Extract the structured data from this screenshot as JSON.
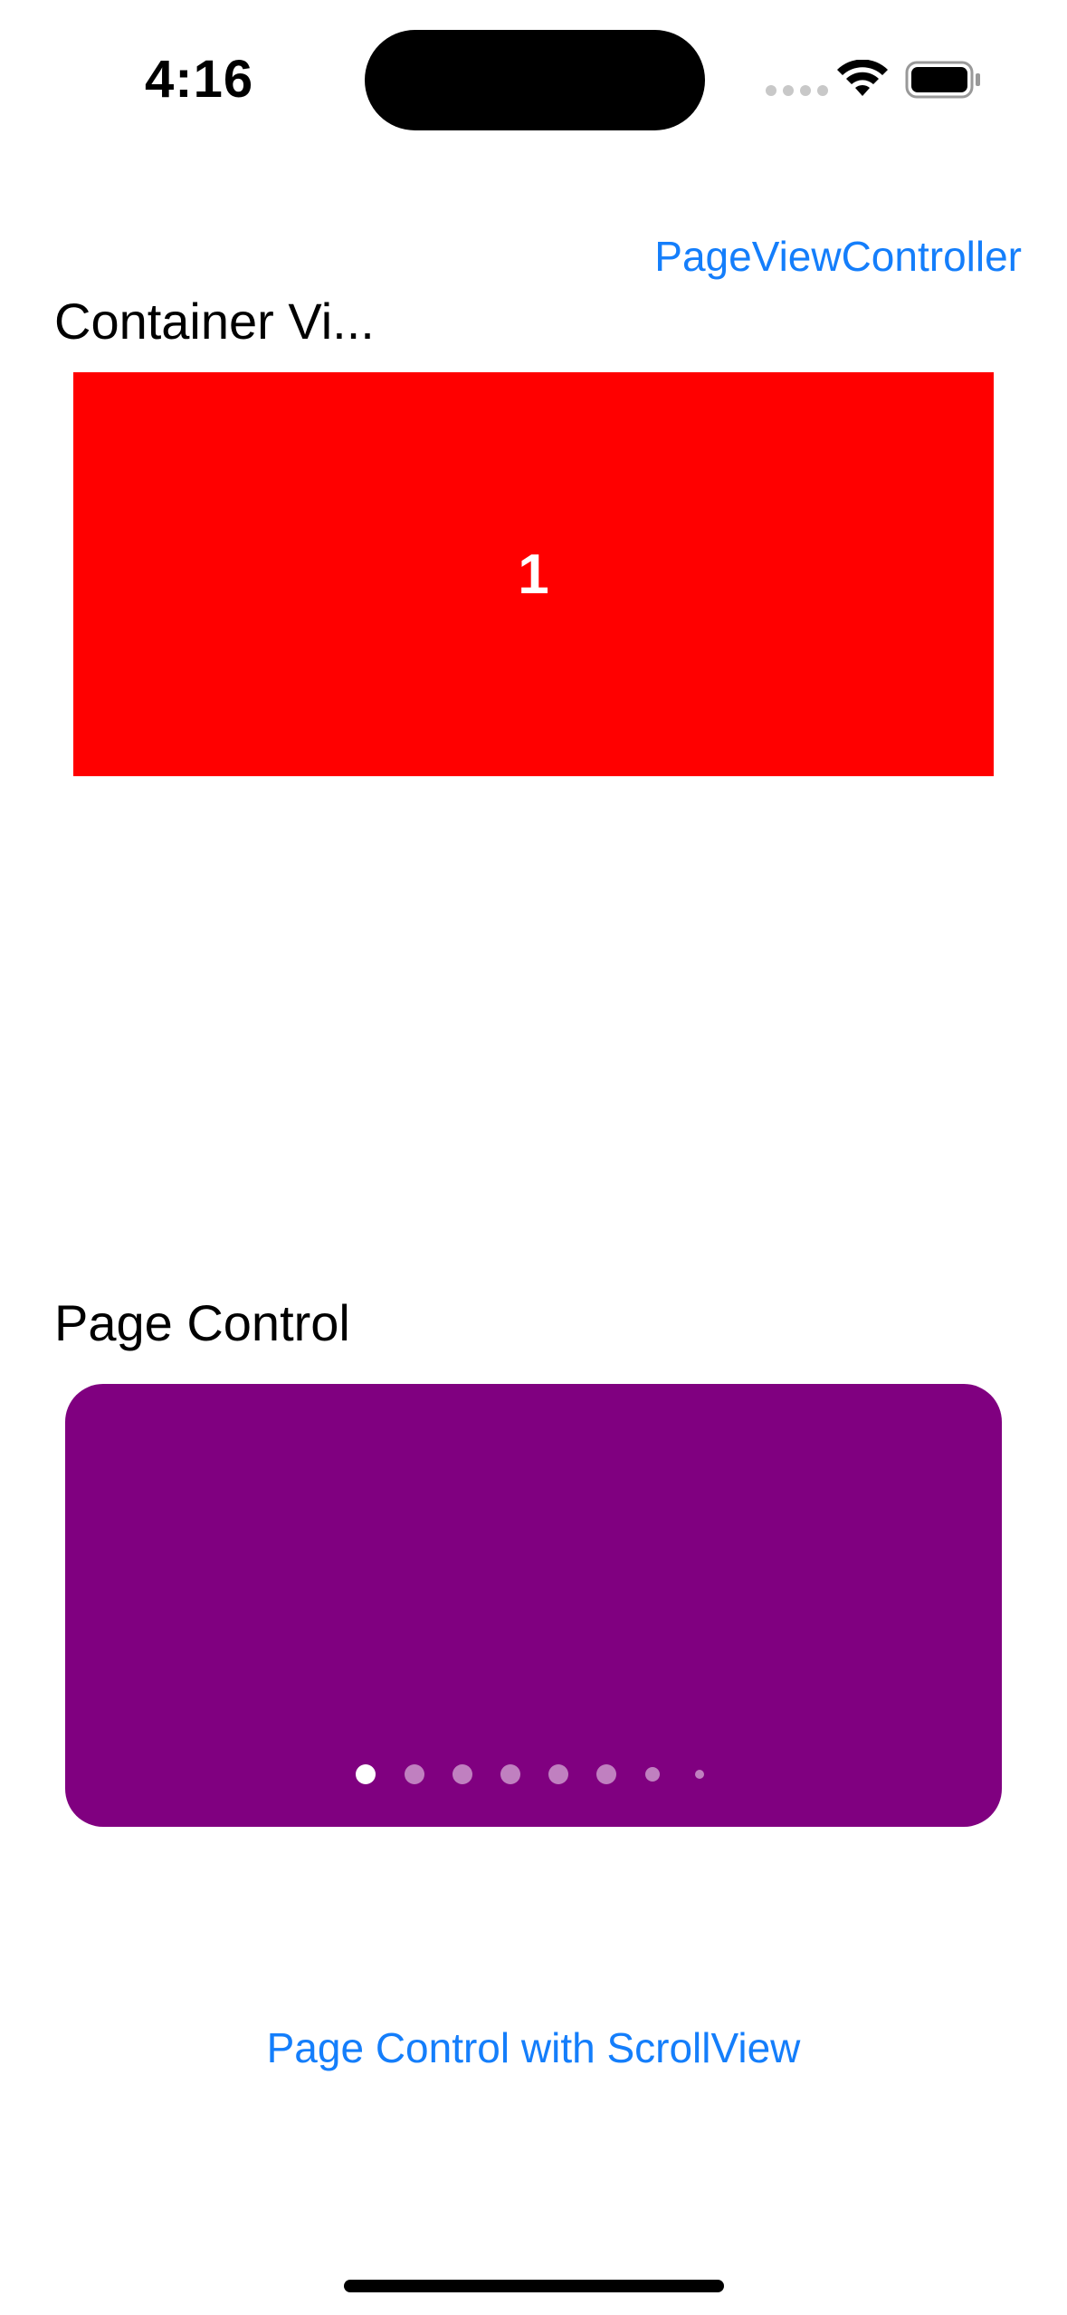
{
  "status_bar": {
    "time": "4:16"
  },
  "nav": {
    "page_view_controller_link": "PageViewController"
  },
  "container_view": {
    "title": "Container Vi...",
    "page": {
      "label": "1",
      "background": "#ff0000"
    }
  },
  "page_control": {
    "title": "Page Control",
    "card_color": "#800080",
    "page_count": 8,
    "current_page": 1
  },
  "links": {
    "page_control_scrollview": "Page Control with ScrollView"
  },
  "colors": {
    "accent": "#147efb",
    "background": "#ffffff"
  },
  "icons": {
    "signal": "cellular-signal-icon",
    "wifi": "wifi-icon",
    "battery": "battery-icon"
  }
}
